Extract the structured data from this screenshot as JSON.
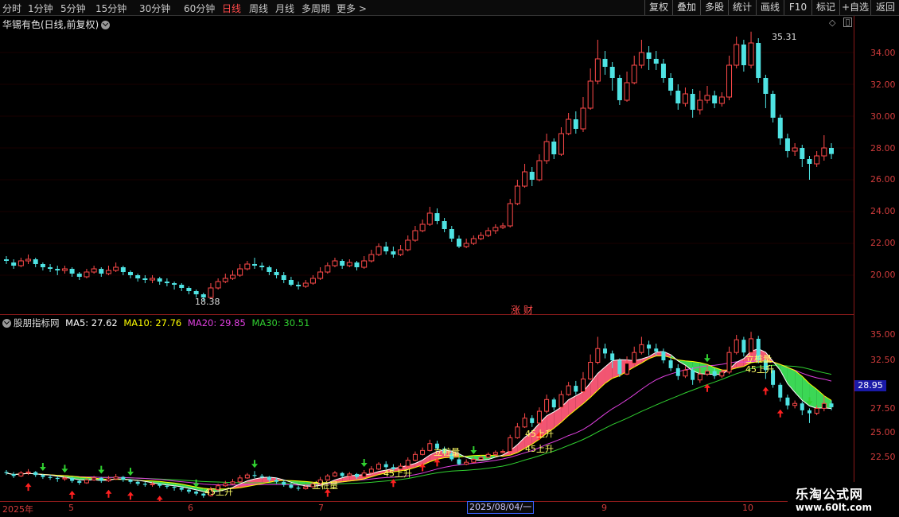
{
  "toolbar": {
    "left_items": [
      "分时",
      "1分钟",
      "5分钟",
      "15分钟",
      "30分钟",
      "60分钟",
      "日线",
      "周线",
      "月线",
      "多周期",
      "更多 >"
    ],
    "active": "日线",
    "right_items": [
      "复权",
      "叠加",
      "多股",
      "统计",
      "画线",
      "F10",
      "+自选",
      "返回"
    ],
    "mark": "标记"
  },
  "main": {
    "title": "华锡有色(日线,前复权)",
    "high_label": "35.31",
    "low_label": "18.38",
    "axis": [
      "34.00",
      "32.00",
      "30.00",
      "28.00",
      "26.00",
      "24.00",
      "22.00",
      "20.00"
    ],
    "event": "涨 财"
  },
  "indicator": {
    "name": "股朋指标网",
    "ma5": "MA5: 27.62",
    "ma10": "MA10: 27.76",
    "ma20": "MA20: 29.85",
    "ma30": "MA30: 30.51",
    "axis": [
      "35.00",
      "32.50",
      "27.50",
      "25.00",
      "22.50"
    ],
    "price_badge": "28.95",
    "signals": [
      "45上升",
      "45上升",
      "45上升",
      "45上升",
      "45上升",
      "立桩量",
      "立桩量",
      "立桩量"
    ]
  },
  "dates": {
    "labels": [
      "2025年",
      "5",
      "6",
      "7",
      "9",
      "10"
    ],
    "marker": "2025/08/04/一"
  },
  "watermark": {
    "line1": "乐淘公式网",
    "line2": "www.60lt.com"
  },
  "colors": {
    "up": "#ff4a4a",
    "down": "#4fe3e3",
    "ma5": "#ffffff",
    "ma10": "#ffff00",
    "ma20": "#e040e0",
    "ma30": "#30d030"
  },
  "chart_data": {
    "type": "candlestick",
    "price_range": [
      18.0,
      35.5
    ],
    "candles": [
      [
        21.0,
        20.9,
        21.2,
        20.7
      ],
      [
        20.8,
        20.6,
        21.0,
        20.4
      ],
      [
        20.6,
        20.9,
        21.1,
        20.5
      ],
      [
        20.9,
        21.0,
        21.3,
        20.7
      ],
      [
        21.0,
        20.7,
        21.1,
        20.5
      ],
      [
        20.7,
        20.5,
        20.8,
        20.3
      ],
      [
        20.5,
        20.4,
        20.7,
        20.2
      ],
      [
        20.4,
        20.3,
        20.6,
        20.0
      ],
      [
        20.3,
        20.4,
        20.6,
        20.1
      ],
      [
        20.4,
        20.1,
        20.5,
        19.9
      ],
      [
        20.1,
        19.9,
        20.2,
        19.7
      ],
      [
        19.9,
        20.2,
        20.4,
        19.8
      ],
      [
        20.2,
        20.4,
        20.6,
        20.1
      ],
      [
        20.4,
        20.1,
        20.5,
        19.9
      ],
      [
        20.1,
        20.3,
        20.6,
        20.0
      ],
      [
        20.3,
        20.5,
        20.8,
        20.2
      ],
      [
        20.5,
        20.2,
        20.6,
        20.0
      ],
      [
        20.2,
        20.0,
        20.3,
        19.8
      ],
      [
        20.0,
        19.8,
        20.1,
        19.6
      ],
      [
        19.8,
        19.7,
        20.0,
        19.5
      ],
      [
        19.7,
        19.8,
        20.0,
        19.5
      ],
      [
        19.8,
        19.6,
        19.9,
        19.4
      ],
      [
        19.6,
        19.5,
        19.8,
        19.3
      ],
      [
        19.5,
        19.4,
        19.6,
        19.1
      ],
      [
        19.4,
        19.2,
        19.5,
        19.0
      ],
      [
        19.2,
        19.0,
        19.3,
        18.8
      ],
      [
        19.0,
        18.8,
        19.1,
        18.6
      ],
      [
        18.8,
        18.6,
        18.9,
        18.38
      ],
      [
        18.6,
        19.2,
        19.5,
        18.5
      ],
      [
        19.2,
        19.6,
        19.8,
        19.1
      ],
      [
        19.6,
        19.8,
        20.1,
        19.5
      ],
      [
        19.8,
        20.0,
        20.3,
        19.7
      ],
      [
        20.0,
        20.4,
        20.7,
        19.9
      ],
      [
        20.4,
        20.7,
        20.9,
        20.3
      ],
      [
        20.7,
        20.6,
        21.1,
        20.4
      ],
      [
        20.6,
        20.5,
        20.8,
        20.3
      ],
      [
        20.5,
        20.2,
        20.6,
        20.0
      ],
      [
        20.2,
        20.0,
        20.4,
        19.8
      ],
      [
        20.0,
        19.7,
        20.2,
        19.5
      ],
      [
        19.7,
        19.4,
        19.9,
        19.3
      ],
      [
        19.4,
        19.3,
        19.6,
        19.1
      ],
      [
        19.3,
        19.5,
        19.7,
        19.2
      ],
      [
        19.5,
        19.8,
        20.0,
        19.4
      ],
      [
        19.8,
        20.2,
        20.5,
        19.7
      ],
      [
        20.2,
        20.6,
        20.8,
        20.1
      ],
      [
        20.6,
        20.9,
        21.1,
        20.5
      ],
      [
        20.9,
        20.6,
        21.0,
        20.4
      ],
      [
        20.6,
        20.8,
        21.0,
        20.5
      ],
      [
        20.8,
        20.5,
        20.9,
        20.3
      ],
      [
        20.5,
        20.9,
        21.2,
        20.4
      ],
      [
        20.9,
        21.3,
        21.6,
        20.8
      ],
      [
        21.3,
        21.8,
        22.0,
        21.2
      ],
      [
        21.8,
        21.5,
        22.1,
        21.3
      ],
      [
        21.5,
        21.3,
        21.8,
        21.1
      ],
      [
        21.3,
        21.6,
        21.9,
        21.2
      ],
      [
        21.6,
        22.2,
        22.5,
        21.5
      ],
      [
        22.2,
        22.8,
        23.1,
        22.1
      ],
      [
        22.8,
        23.2,
        23.5,
        22.7
      ],
      [
        23.2,
        23.9,
        24.3,
        23.1
      ],
      [
        23.9,
        23.4,
        24.2,
        23.2
      ],
      [
        23.4,
        22.9,
        23.6,
        22.7
      ],
      [
        22.9,
        22.3,
        23.1,
        22.1
      ],
      [
        22.3,
        21.8,
        22.5,
        21.7
      ],
      [
        21.8,
        22.0,
        22.3,
        21.7
      ],
      [
        22.0,
        22.3,
        22.5,
        21.9
      ],
      [
        22.3,
        22.5,
        22.7,
        22.2
      ],
      [
        22.5,
        22.8,
        23.0,
        22.4
      ],
      [
        22.8,
        23.0,
        23.2,
        22.6
      ],
      [
        23.0,
        23.1,
        23.3,
        22.9
      ],
      [
        23.1,
        24.5,
        24.8,
        23.0
      ],
      [
        24.5,
        25.6,
        26.0,
        24.4
      ],
      [
        25.6,
        26.5,
        27.0,
        25.5
      ],
      [
        26.5,
        26.0,
        26.8,
        25.6
      ],
      [
        26.0,
        27.2,
        27.6,
        25.9
      ],
      [
        27.2,
        28.4,
        28.9,
        27.0
      ],
      [
        28.4,
        27.6,
        28.6,
        27.3
      ],
      [
        27.6,
        28.9,
        29.3,
        27.5
      ],
      [
        28.9,
        29.8,
        30.2,
        28.8
      ],
      [
        29.8,
        29.2,
        30.3,
        28.9
      ],
      [
        29.2,
        30.5,
        31.2,
        29.0
      ],
      [
        30.5,
        32.2,
        33.0,
        30.4
      ],
      [
        32.2,
        33.6,
        34.8,
        32.0
      ],
      [
        33.6,
        33.1,
        34.1,
        32.6
      ],
      [
        33.1,
        32.4,
        33.4,
        31.6
      ],
      [
        32.4,
        31.0,
        32.6,
        30.7
      ],
      [
        31.0,
        32.1,
        32.8,
        30.9
      ],
      [
        32.1,
        33.2,
        33.8,
        32.0
      ],
      [
        33.2,
        34.0,
        34.8,
        33.0
      ],
      [
        34.0,
        33.6,
        34.4,
        32.9
      ],
      [
        33.6,
        33.3,
        34.1,
        32.9
      ],
      [
        33.3,
        32.4,
        33.6,
        32.1
      ],
      [
        32.4,
        31.6,
        32.7,
        31.3
      ],
      [
        31.6,
        30.8,
        32.0,
        30.4
      ],
      [
        30.8,
        31.4,
        31.8,
        30.6
      ],
      [
        31.4,
        30.4,
        31.7,
        29.9
      ],
      [
        30.4,
        31.0,
        31.6,
        30.1
      ],
      [
        31.0,
        31.3,
        31.9,
        30.8
      ],
      [
        31.3,
        30.8,
        31.6,
        30.5
      ],
      [
        30.8,
        31.2,
        31.5,
        30.6
      ],
      [
        31.2,
        33.2,
        33.8,
        31.0
      ],
      [
        33.2,
        34.5,
        35.0,
        33.0
      ],
      [
        34.5,
        33.2,
        34.8,
        32.8
      ],
      [
        33.2,
        34.6,
        35.31,
        33.0
      ],
      [
        34.6,
        32.4,
        34.9,
        32.1
      ],
      [
        32.4,
        31.4,
        32.6,
        30.5
      ],
      [
        31.4,
        29.9,
        31.6,
        29.6
      ],
      [
        29.9,
        28.6,
        30.1,
        28.2
      ],
      [
        28.6,
        27.8,
        28.9,
        27.4
      ],
      [
        27.8,
        28.0,
        28.3,
        27.5
      ],
      [
        28.0,
        27.3,
        28.2,
        26.8
      ],
      [
        27.3,
        27.0,
        27.5,
        26.0
      ],
      [
        27.0,
        27.5,
        27.8,
        26.8
      ],
      [
        27.5,
        28.0,
        28.8,
        27.2
      ],
      [
        28.0,
        27.62,
        28.3,
        27.3
      ]
    ]
  }
}
